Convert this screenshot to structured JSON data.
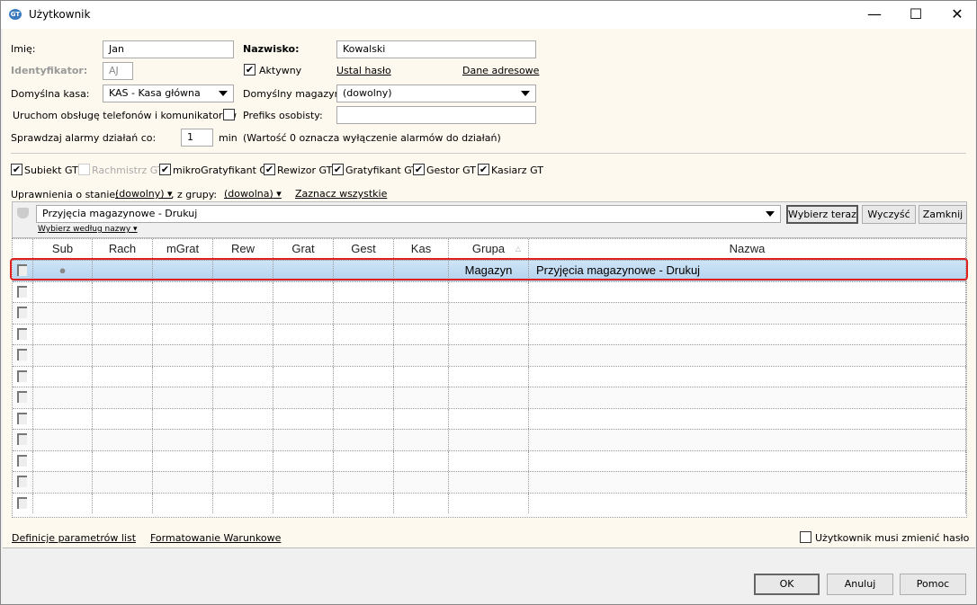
{
  "window": {
    "title": "Użytkownik",
    "controls": [
      "minimize",
      "maximize",
      "close"
    ]
  },
  "form": {
    "first_name_label": "Imię:",
    "first_name": "Jan",
    "last_name_label": "Nazwisko:",
    "last_name": "Kowalski",
    "id_label": "Identyfikator:",
    "id": "AJ",
    "active_label": "Aktywny",
    "active": true,
    "set_password": "Ustal hasło",
    "address": "Dane adresowe",
    "cash_label": "Domyślna kasa:",
    "cash": "KAS - Kasa główna",
    "warehouse_label": "Domyślny magazyn:",
    "warehouse": "(dowolny)",
    "phones_label": "Uruchom obsługę telefonów i komunikatorów",
    "phones": false,
    "prefix_label": "Prefiks osobisty:",
    "prefix": "",
    "alarm_label": "Sprawdzaj alarmy działań co:",
    "alarm_value": "1",
    "alarm_unit": "min",
    "alarm_note": "(Wartość 0 oznacza wyłączenie alarmów do działań)"
  },
  "modules": [
    {
      "label": "Subiekt GT",
      "checked": true,
      "enabled": true
    },
    {
      "label": "Rachmistrz GT",
      "checked": false,
      "enabled": false
    },
    {
      "label": "mikroGratyfikant GT",
      "checked": true,
      "enabled": true
    },
    {
      "label": "Rewizor GT",
      "checked": true,
      "enabled": true
    },
    {
      "label": "Gratyfikant GT",
      "checked": true,
      "enabled": true
    },
    {
      "label": "Gestor GT",
      "checked": true,
      "enabled": true
    },
    {
      "label": "Kasiarz GT",
      "checked": true,
      "enabled": true
    }
  ],
  "filter": {
    "state_label": "Uprawnienia o stanie:",
    "state": "(dowolny)",
    "group_label": ", z grupy:",
    "group": "(dowolna)",
    "select_all": "Zaznacz wszystkie",
    "search": "Przyjęcia magazynowe - Drukuj",
    "by_name": "Wybierz według nazwy",
    "choose_now": "Wybierz teraz",
    "clear": "Wyczyść",
    "close": "Zamknij"
  },
  "grid": {
    "columns": [
      "Sub",
      "Rach",
      "mGrat",
      "Rew",
      "Grat",
      "Gest",
      "Kas",
      "Grupa",
      "Nazwa"
    ],
    "sort_column": "Grupa",
    "rows": [
      {
        "Sub": "●",
        "Rach": "",
        "mGrat": "",
        "Rew": "",
        "Grat": "",
        "Gest": "",
        "Kas": "",
        "Grupa": "Magazyn",
        "Nazwa": "Przyjęcia magazynowe - Drukuj",
        "selected": true
      }
    ],
    "empty_rows": 11
  },
  "footer": {
    "list_params": "Definicje parametrów list",
    "conditional": "Formatowanie Warunkowe",
    "must_change_label": "Użytkownik musi zmienić hasło",
    "must_change": false,
    "ok": "OK",
    "cancel": "Anuluj",
    "help": "Pomoc"
  },
  "colors": {
    "panel": "#fdf9ee",
    "selected_row": "#bcd8f0",
    "highlight": "#e02020"
  }
}
